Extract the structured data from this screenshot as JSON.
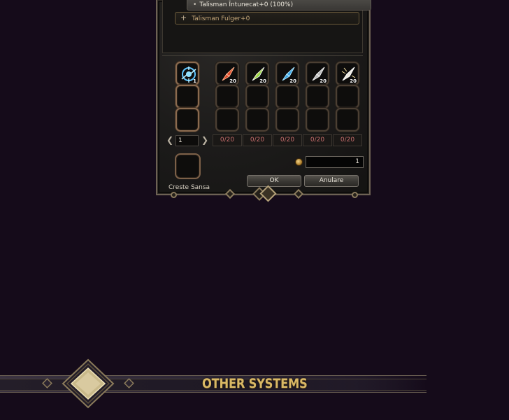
{
  "recipe_list": {
    "selected_item": "Talisman Întunecat+0 (100%)",
    "collapsed_item": "Talisman Fulger+0"
  },
  "main_slot": {
    "qty": "1",
    "icon": "blue-talisman-icon"
  },
  "materials": [
    {
      "icon": "red-crystal-icon",
      "color": "#e04a2a",
      "qty": "20",
      "counter": "0/20"
    },
    {
      "icon": "rainbow-crystal-icon",
      "color": "#5fd04a",
      "qty": "20",
      "counter": "0/20"
    },
    {
      "icon": "blue-crystal-icon",
      "color": "#39a6e6",
      "qty": "20",
      "counter": "0/20"
    },
    {
      "icon": "silver-crystal-icon",
      "color": "#c9c9c9",
      "qty": "20",
      "counter": "0/20"
    },
    {
      "icon": "white-crystal-icon",
      "color": "#f2efe6",
      "qty": "20",
      "counter": "0/20"
    }
  ],
  "pager": {
    "value": "1"
  },
  "chance": {
    "label": "Creste Sansa"
  },
  "gold": {
    "value": "1",
    "icon": "coin-icon"
  },
  "buttons": {
    "ok": "OK",
    "cancel": "Anulare"
  },
  "banner": {
    "title": "OTHER SYSTEMS"
  },
  "colors": {
    "background": "#150b1a",
    "counter_text": "#c66c6c",
    "banner_text": "#d9b865"
  }
}
